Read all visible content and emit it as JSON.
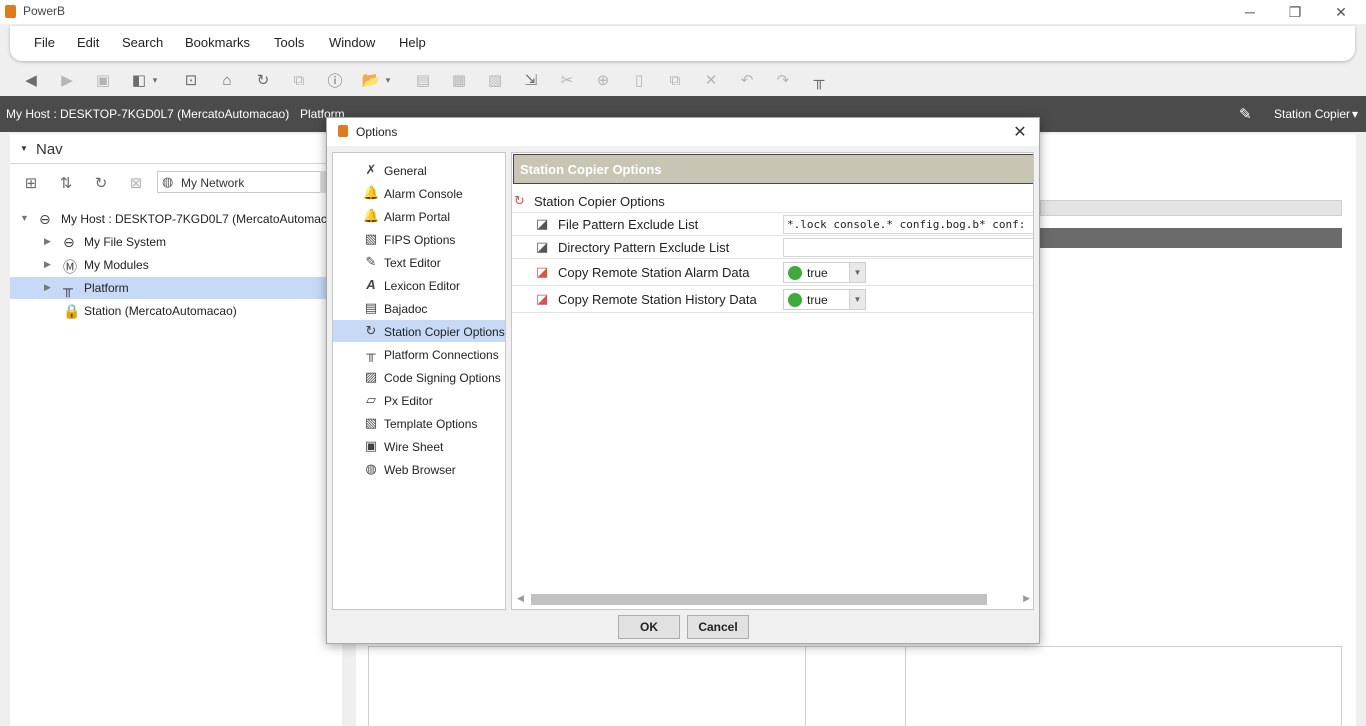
{
  "app": {
    "title": "PowerB",
    "minimize": "─",
    "restore": "❐",
    "close": "✕"
  },
  "menu": [
    "File",
    "Edit",
    "Search",
    "Bookmarks",
    "Tools",
    "Window",
    "Help"
  ],
  "pathbar": {
    "host": "My Host : DESKTOP-7KGD0L7 (MercatoAutomacao)",
    "separator": ":",
    "platform": "Platform",
    "view_name": "Station Copier",
    "view_arrow": "▾"
  },
  "nav": {
    "title": "Nav",
    "search_value": "My Network",
    "tree": [
      {
        "label": "My Host : DESKTOP-7KGD0L7 (MercatoAutomacao)",
        "expanded": true
      },
      {
        "label": "My File System"
      },
      {
        "label": "My Modules"
      },
      {
        "label": "Platform",
        "selected": true
      },
      {
        "label": "Station (MercatoAutomacao)"
      }
    ]
  },
  "background": {
    "quote_fragment": "\""
  },
  "dialog": {
    "title": "Options",
    "list": [
      {
        "label": "General",
        "icon": "wrench-icon"
      },
      {
        "label": "Alarm Console",
        "icon": "bell-icon"
      },
      {
        "label": "Alarm Portal",
        "icon": "bell-icon"
      },
      {
        "label": "FIPS Options",
        "icon": "document-icon"
      },
      {
        "label": "Text Editor",
        "icon": "pencil-icon"
      },
      {
        "label": "Lexicon Editor",
        "icon": "lexicon-icon"
      },
      {
        "label": "Bajadoc",
        "icon": "doc-icon"
      },
      {
        "label": "Station Copier Options",
        "icon": "sync-icon",
        "selected": true
      },
      {
        "label": "Platform Connections",
        "icon": "connector-icon"
      },
      {
        "label": "Code Signing Options",
        "icon": "certificate-icon"
      },
      {
        "label": "Px Editor",
        "icon": "px-icon"
      },
      {
        "label": "Template Options",
        "icon": "template-icon"
      },
      {
        "label": "Wire Sheet",
        "icon": "wiresheet-icon"
      },
      {
        "label": "Web Browser",
        "icon": "globe-icon"
      }
    ],
    "content_header": "Station Copier Options",
    "root_label": "Station Copier Options",
    "properties": [
      {
        "name": "File Pattern Exclude List",
        "value": "*.lock console.* config.bog.b* conf:"
      },
      {
        "name": "Directory Pattern Exclude List",
        "value": ""
      },
      {
        "name": "Copy Remote Station Alarm Data",
        "value": "true"
      },
      {
        "name": "Copy Remote Station History Data",
        "value": "true"
      }
    ],
    "ok_label": "OK",
    "cancel_label": "Cancel"
  },
  "colors": {
    "accent": "#e07a1f",
    "selection": "#c6d9f7",
    "pathbar": "#4b4b4b",
    "header_bar": "#c9c5b4",
    "true_dot": "#3cab3c"
  }
}
